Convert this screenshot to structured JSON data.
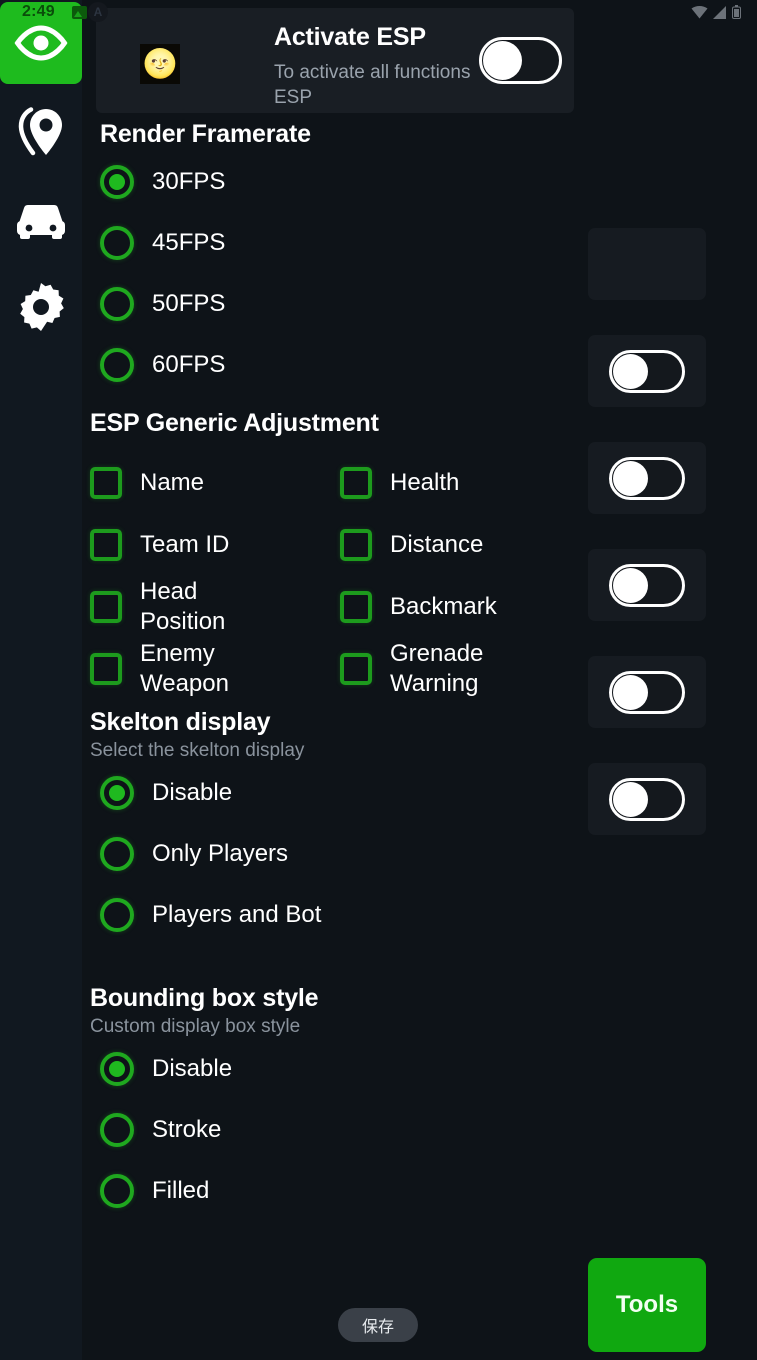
{
  "status_bar": {
    "time": "2:49",
    "photo_icon": "image-icon",
    "app_badge": "A",
    "right_icons": [
      "wifi-icon",
      "signal-icon",
      "battery-icon"
    ]
  },
  "sidebar": {
    "items": [
      {
        "name": "eye-icon",
        "label": "ESP",
        "active": true
      },
      {
        "name": "location-pin-icon",
        "label": "Location",
        "active": false
      },
      {
        "name": "car-icon",
        "label": "Vehicle",
        "active": false
      },
      {
        "name": "gear-icon",
        "label": "Settings",
        "active": false
      }
    ]
  },
  "esp_card": {
    "avatar": "moon-face-icon",
    "title": "Activate ESP",
    "subtitle": "To activate all functions ESP",
    "toggle": {
      "name": "activate-esp-toggle",
      "state": "off"
    }
  },
  "sections": [
    {
      "id": "render-framerate",
      "title": "Render Framerate",
      "subtitle": "",
      "options": [
        {
          "label": "30FPS",
          "selected": true
        },
        {
          "label": "45FPS",
          "selected": false
        },
        {
          "label": "50FPS",
          "selected": false
        },
        {
          "label": "60FPS",
          "selected": false
        }
      ]
    },
    {
      "id": "skelton-display",
      "title": "Skelton display",
      "subtitle": "Select the skelton display",
      "options": [
        {
          "label": "Disable",
          "selected": true
        },
        {
          "label": "Only Players",
          "selected": false
        },
        {
          "label": "Players and Bot",
          "selected": false
        }
      ]
    },
    {
      "id": "bounding-box-style",
      "title": "Bounding box style",
      "subtitle": "Custom display box style",
      "options": [
        {
          "label": "Disable",
          "selected": true
        },
        {
          "label": "Stroke",
          "selected": false
        },
        {
          "label": "Filled",
          "selected": false
        }
      ]
    }
  ],
  "esp_generic": {
    "title": "ESP Generic Adjustment",
    "checkboxes": [
      {
        "label": "Name",
        "checked": false
      },
      {
        "label": "Health",
        "checked": false
      },
      {
        "label": "Team ID",
        "checked": false
      },
      {
        "label": "Distance",
        "checked": false
      },
      {
        "label": "Head Position",
        "checked": false
      },
      {
        "label": "Backmark",
        "checked": false
      },
      {
        "label": "Enemy Weapon",
        "checked": false
      },
      {
        "label": "Grenade Warning",
        "checked": false
      }
    ]
  },
  "right_panel": {
    "rows": [
      {
        "has_toggle": false,
        "state": ""
      },
      {
        "has_toggle": true,
        "state": "off"
      },
      {
        "has_toggle": true,
        "state": "off"
      },
      {
        "has_toggle": true,
        "state": "off"
      },
      {
        "has_toggle": true,
        "state": "off"
      },
      {
        "has_toggle": true,
        "state": "off"
      }
    ]
  },
  "buttons": {
    "save": "保存",
    "tools": "Tools"
  },
  "colors": {
    "accent_green": "#1fb91f",
    "tools_green": "#10a810",
    "rail_active": "#1ebb1e",
    "background": "#0e1318",
    "card": "#191e24",
    "muted_text": "#8a939d"
  }
}
